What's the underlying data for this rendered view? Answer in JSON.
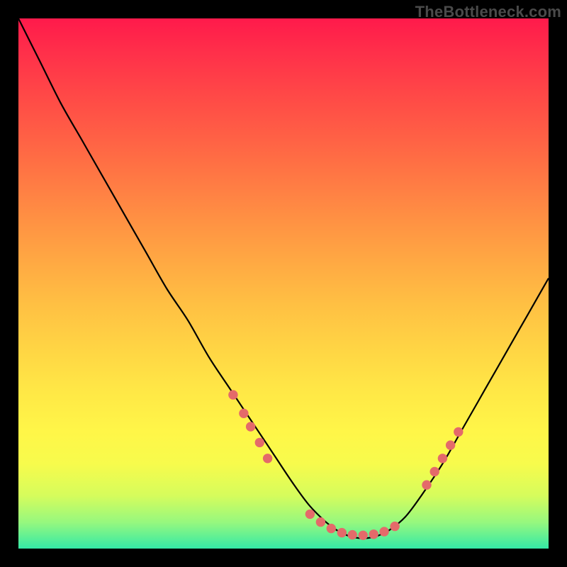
{
  "watermark": "TheBottleneck.com",
  "chart_data": {
    "type": "line",
    "title": "",
    "xlabel": "",
    "ylabel": "",
    "xlim": [
      0,
      100
    ],
    "ylim": [
      0,
      100
    ],
    "grid": false,
    "legend": false,
    "series": [
      {
        "name": "curve",
        "x": [
          0,
          4,
          8,
          12,
          16,
          20,
          24,
          28,
          32,
          36,
          40,
          44,
          48,
          52,
          55,
          58,
          60,
          62,
          64,
          66,
          68,
          70,
          73,
          76,
          80,
          84,
          88,
          92,
          96,
          100
        ],
        "y": [
          100,
          92,
          84,
          77,
          70,
          63,
          56,
          49,
          43,
          36,
          30,
          24,
          18,
          12,
          8,
          5,
          3.5,
          2.5,
          2,
          2,
          2.5,
          3.5,
          6,
          10,
          16,
          23,
          30,
          37,
          44,
          51
        ],
        "color": "#000000"
      }
    ],
    "markers": {
      "name": "dots",
      "color": "#e46a6a",
      "radius_pct": 0.9,
      "points_xy": [
        [
          40.5,
          29
        ],
        [
          42.5,
          25.5
        ],
        [
          43.8,
          23
        ],
        [
          45.5,
          20
        ],
        [
          47,
          17
        ],
        [
          55,
          6.5
        ],
        [
          57,
          5
        ],
        [
          59,
          3.8
        ],
        [
          61,
          3
        ],
        [
          63,
          2.6
        ],
        [
          65,
          2.5
        ],
        [
          67,
          2.7
        ],
        [
          69,
          3.2
        ],
        [
          71,
          4.2
        ],
        [
          77,
          12
        ],
        [
          78.5,
          14.5
        ],
        [
          80,
          17
        ],
        [
          81.5,
          19.5
        ],
        [
          83,
          22
        ]
      ]
    }
  }
}
